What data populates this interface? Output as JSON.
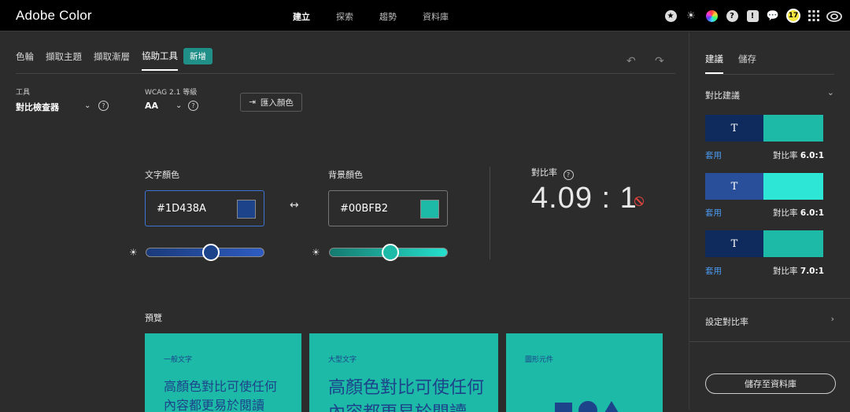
{
  "app": {
    "title": "Adobe Color"
  },
  "topnav": {
    "items": [
      "建立",
      "探索",
      "趨勢",
      "資料庫"
    ],
    "active": "建立"
  },
  "topicons": [
    "star-badge-icon",
    "sun-icon",
    "color-wheel-icon",
    "help-icon",
    "feedback-icon",
    "chat-icon",
    "avatar",
    "apps-grid-icon",
    "creative-cloud-icon"
  ],
  "tabs": {
    "items": [
      "色輪",
      "擷取主題",
      "擷取漸層",
      "協助工具"
    ],
    "active": "協助工具",
    "new_badge": "新增"
  },
  "tool": {
    "label": "工具",
    "value": "對比檢查器"
  },
  "wcag": {
    "label": "WCAG 2.1 等級",
    "value": "AA"
  },
  "import_button": "匯入顏色",
  "text_color": {
    "label": "文字顏色",
    "hex": "#1D438A",
    "swatch": "#1D438A",
    "brightness": 0.55
  },
  "bg_color": {
    "label": "背景顏色",
    "hex": "#00BFB2",
    "swatch": "#1dbaa8",
    "brightness": 0.52
  },
  "contrast": {
    "label": "對比率",
    "value": "4.09 : 1"
  },
  "preview": {
    "label": "預覽",
    "cards": [
      {
        "title": "一般文字",
        "sample": "高顏色對比可使任何內容都更易於閱讀"
      },
      {
        "title": "大型文字",
        "sample": "高顏色對比可使任何內容都更易於閱讀"
      },
      {
        "title": "圖形元件"
      }
    ]
  },
  "right_panel": {
    "tabs": [
      "建議",
      "儲存"
    ],
    "active_tab": "建議",
    "suggestions_title": "對比建議",
    "suggestions": [
      {
        "glyph": "T",
        "text_color": "#0f2a5c",
        "bg_color": "#1dbaa8",
        "apply": "套用",
        "ratio_label": "對比率",
        "ratio": "6.0:1"
      },
      {
        "glyph": "T",
        "text_color": "#2a4f9a",
        "bg_color": "#2ee6d6",
        "apply": "套用",
        "ratio_label": "對比率",
        "ratio": "6.0:1"
      },
      {
        "glyph": "T",
        "text_color": "#0f2a5c",
        "bg_color": "#1dbaa8",
        "apply": "套用",
        "ratio_label": "對比率",
        "ratio": "7.0:1"
      }
    ],
    "set_ratio": "設定對比率",
    "save_button": "儲存至資料庫"
  }
}
